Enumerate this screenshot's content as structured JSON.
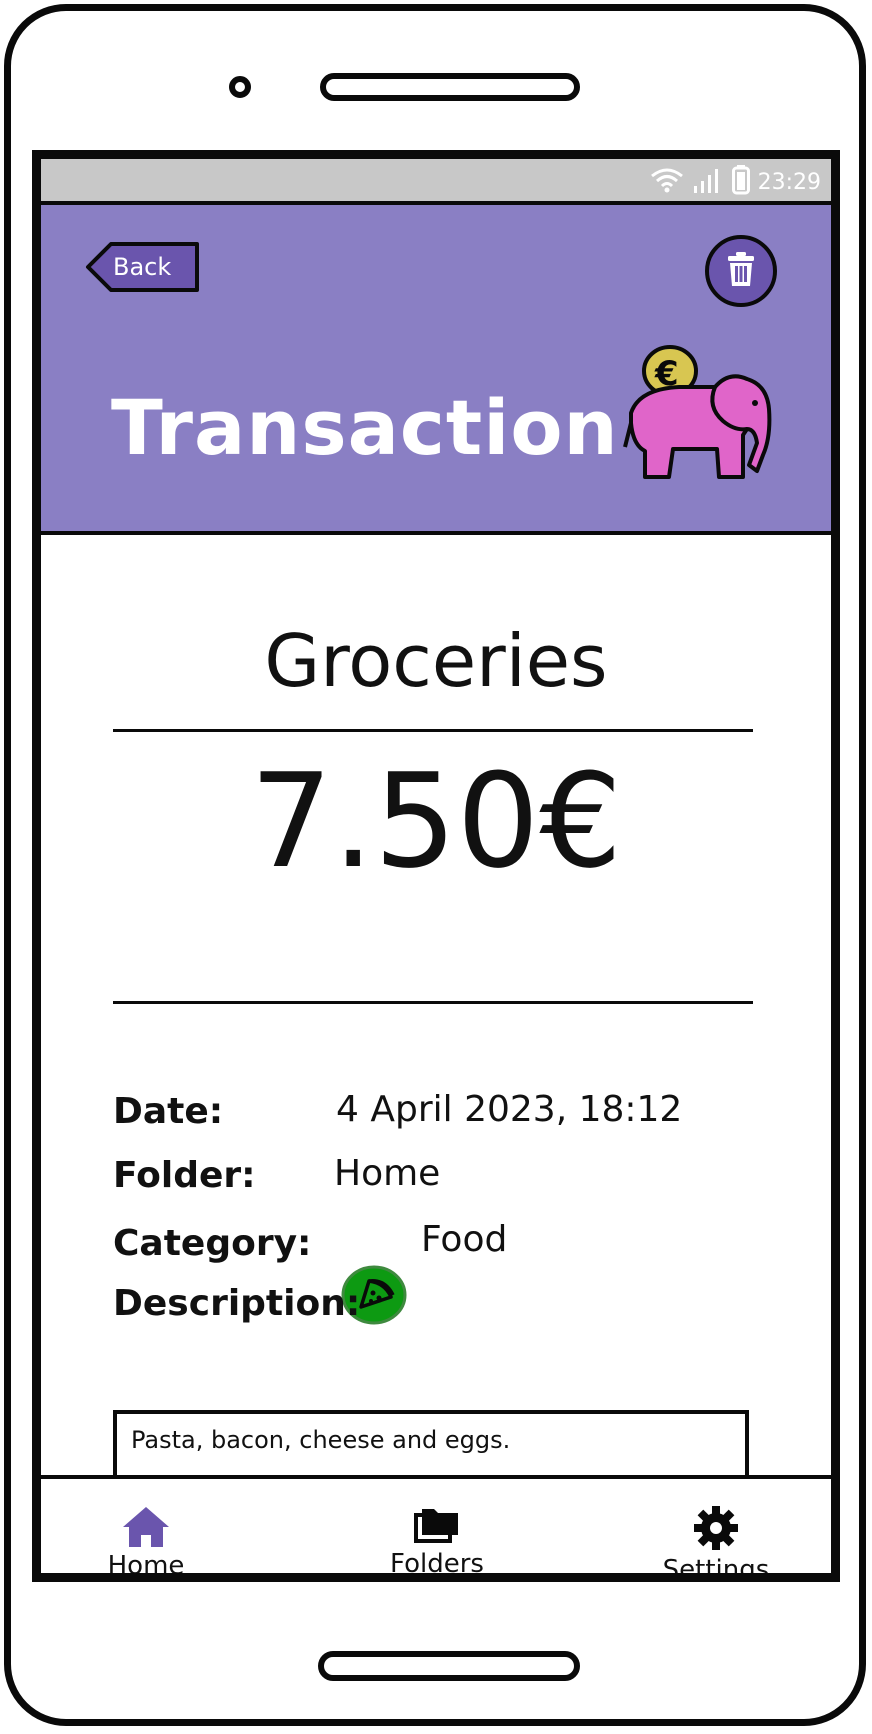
{
  "status_bar": {
    "time": "23:29",
    "icons": [
      "wifi-icon",
      "signal-icon",
      "battery-icon"
    ]
  },
  "header": {
    "back_label": "Back",
    "title": "Transaction",
    "accent": "#8a7fc4",
    "button_color": "#6a55ad"
  },
  "transaction": {
    "name": "Groceries",
    "amount": "7.50€",
    "fields": {
      "date_label": "Date:",
      "date_value": "4 April 2023, 18:12",
      "folder_label": "Folder:",
      "folder_value": "Home",
      "category_label": "Category:",
      "category_value": "Food",
      "category_icon": "pizza-icon",
      "description_label": "Description:",
      "description_value": "Pasta, bacon, cheese and eggs."
    }
  },
  "nav": {
    "items": [
      {
        "label": "Home",
        "icon": "home-icon",
        "active": true
      },
      {
        "label": "Folders",
        "icon": "folder-icon",
        "active": false
      },
      {
        "label": "Settings",
        "icon": "gear-icon",
        "active": false
      }
    ]
  }
}
